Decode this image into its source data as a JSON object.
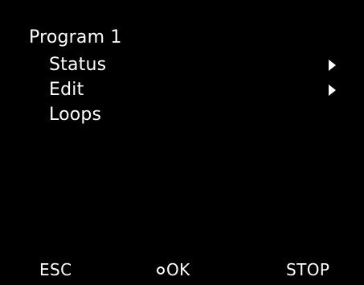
{
  "screen": {
    "title": "Program 1",
    "menu": {
      "items": [
        {
          "label": "Status",
          "has_submenu": true
        },
        {
          "label": "Edit",
          "has_submenu": true
        },
        {
          "label": "Loops",
          "has_submenu": false
        }
      ]
    },
    "softkeys": {
      "esc": "ESC",
      "ok": "OK",
      "ok_icon": "circle-icon",
      "stop": "STOP"
    }
  },
  "colors": {
    "background": "#000000",
    "text": "#ffffff"
  }
}
